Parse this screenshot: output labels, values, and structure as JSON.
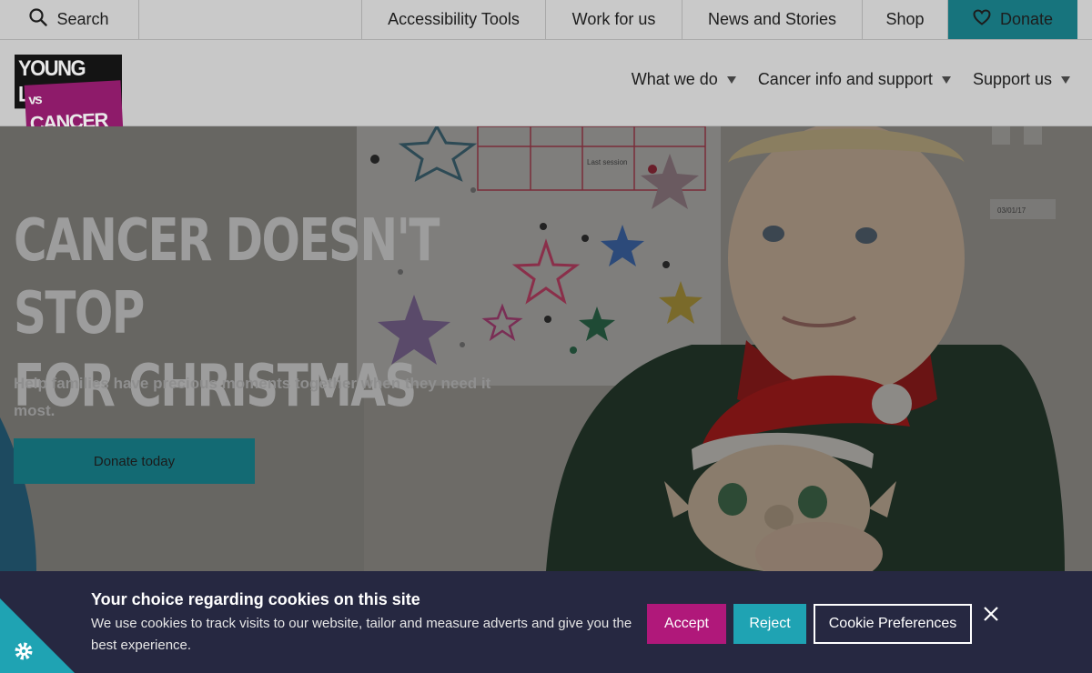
{
  "topbar": {
    "search_label": "Search",
    "links": [
      "Accessibility Tools",
      "Work for us",
      "News and Stories",
      "Shop"
    ],
    "donate_label": "Donate"
  },
  "logo": {
    "line1": "YOUNG LIVES",
    "line2_vs": "vs",
    "line2": "CANCER"
  },
  "nav": {
    "items": [
      "What we do",
      "Cancer info and support",
      "Support us"
    ]
  },
  "hero": {
    "heading_line1": "CANCER DOESN'T STOP",
    "heading_line2": "FOR CHRISTMAS",
    "subtext": "Help families have precious moments together when they need it most.",
    "cta_label": "Donate today",
    "chart_text": "Last session",
    "date_label": "03/01/17"
  },
  "cookie": {
    "title": "Your choice regarding cookies on this site",
    "text": "We use cookies to track visits to our website, tailor and measure adverts and give you the best experience.",
    "accept_label": "Accept",
    "reject_label": "Reject",
    "prefs_label": "Cookie Preferences"
  },
  "colors": {
    "teal": "#1fa3b3",
    "magenta": "#b0187a",
    "banner": "#262841"
  }
}
